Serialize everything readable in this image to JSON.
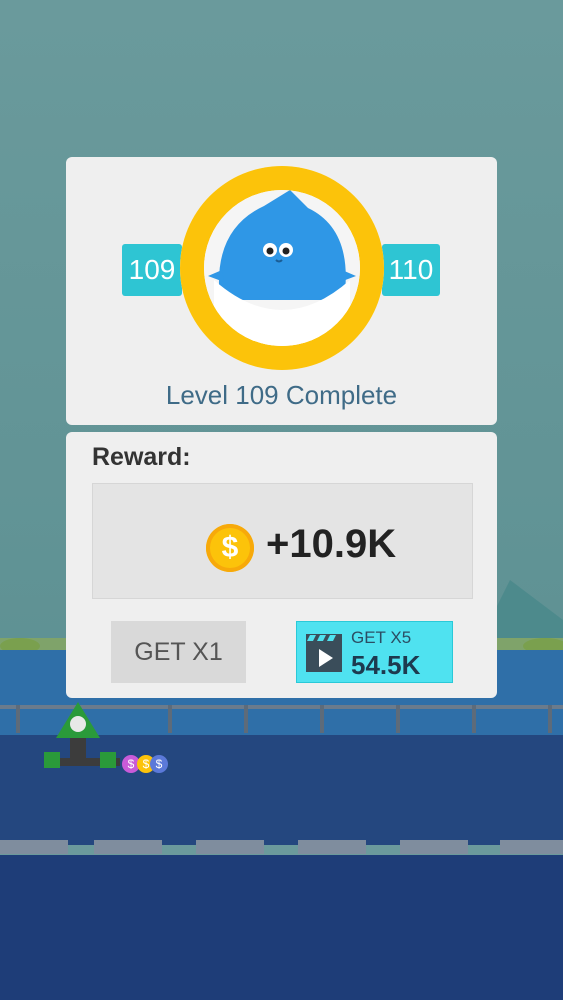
{
  "level_card": {
    "current_level": "109",
    "next_level": "110",
    "title": "Level 109 Complete"
  },
  "reward": {
    "label": "Reward:",
    "coin_symbol": "$",
    "value": "+10.9K"
  },
  "buttons": {
    "get_x1": "GET X1",
    "get_x5_label": "GET X5",
    "get_x5_value": "54.5K"
  },
  "background_coins": [
    "$",
    "$",
    "$"
  ],
  "colors": {
    "accent_cyan": "#2ec5d3",
    "ring_yellow": "#fcc30a",
    "shark_blue": "#2f97e6",
    "x5_button": "#4fe2f0"
  }
}
